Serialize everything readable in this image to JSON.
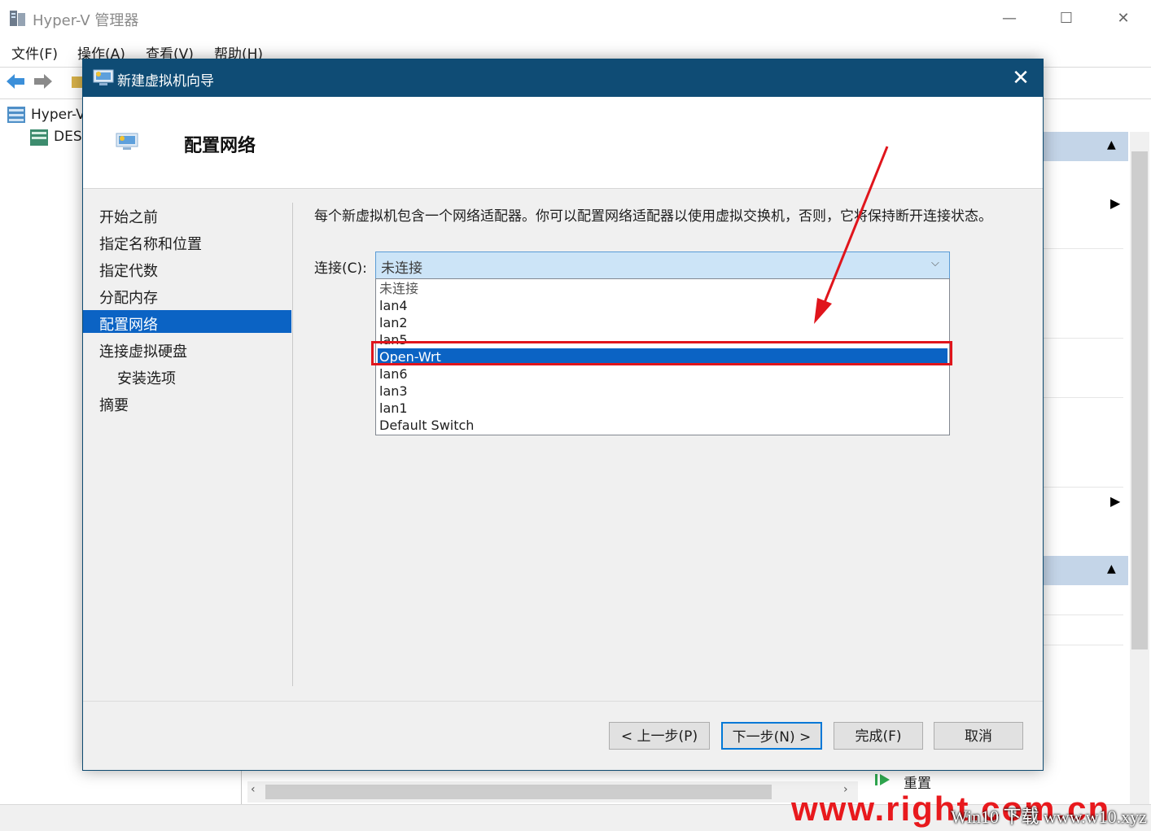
{
  "app": {
    "title": "Hyper-V 管理器",
    "menu": [
      "文件(F)",
      "操作(A)",
      "查看(V)",
      "帮助(H)"
    ],
    "window_controls": {
      "minimize": "—",
      "maximize": "☐",
      "close": "✕"
    }
  },
  "tree": {
    "root": "Hyper-V",
    "child": "DES"
  },
  "actions": {
    "item_reset": "重置"
  },
  "dialog": {
    "title": "新建虚拟机向导",
    "close_glyph": "✕",
    "page_title": "配置网络",
    "nav": [
      {
        "label": "开始之前",
        "selected": false
      },
      {
        "label": "指定名称和位置",
        "selected": false
      },
      {
        "label": "指定代数",
        "selected": false
      },
      {
        "label": "分配内存",
        "selected": false
      },
      {
        "label": "配置网络",
        "selected": true
      },
      {
        "label": "连接虚拟硬盘",
        "selected": false
      },
      {
        "label": "安装选项",
        "selected": false
      },
      {
        "label": "摘要",
        "selected": false
      }
    ],
    "description": "每个新虚拟机包含一个网络适配器。你可以配置网络适配器以使用虚拟交换机，否则，它将保持断开连接状态。",
    "connection_label": "连接(C):",
    "connection_value": "未连接",
    "options": [
      "未连接",
      "lan4",
      "lan2",
      "lan5",
      "Open-Wrt",
      "lan6",
      "lan3",
      "lan1",
      "Default Switch"
    ],
    "highlighted_option": "Open-Wrt",
    "buttons": {
      "prev": "< 上一步(P)",
      "next": "下一步(N) >",
      "finish": "完成(F)",
      "cancel": "取消"
    }
  },
  "watermark": {
    "main": "www.right.com.cn",
    "secondary": "Win10 下载 www.w10.xyz"
  },
  "colors": {
    "dialog_title_bg": "#0f4c75",
    "selection": "#0b63c4",
    "annotation_red": "#e0151c"
  }
}
